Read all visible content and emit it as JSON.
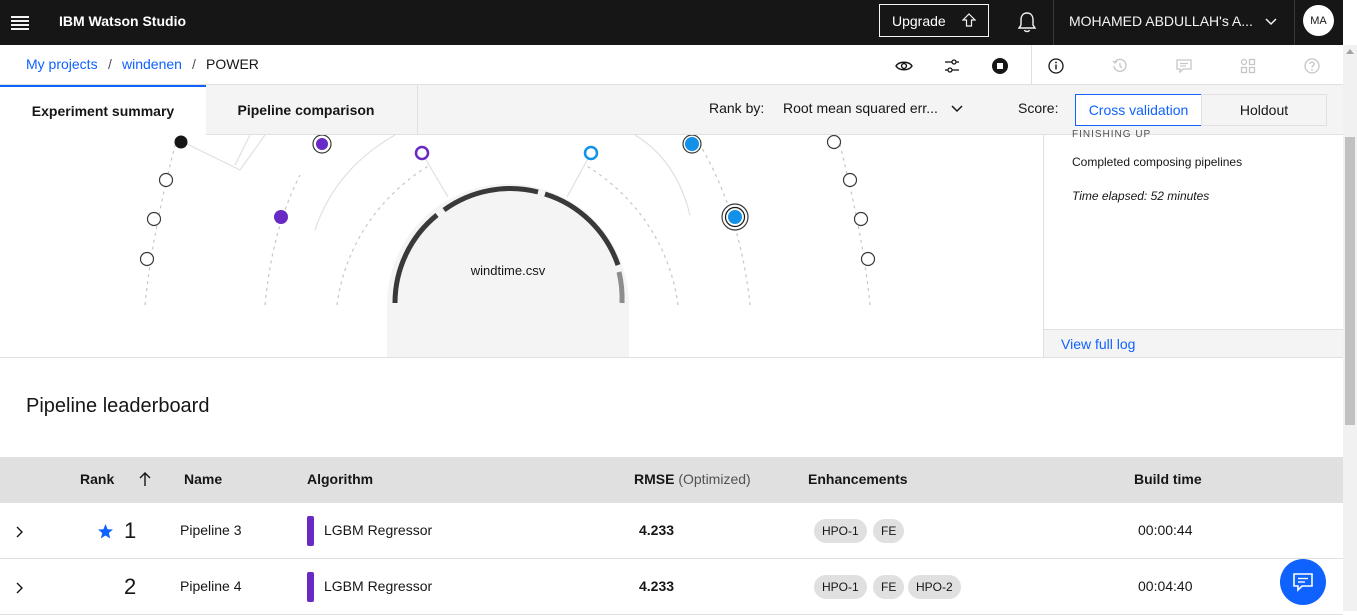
{
  "header": {
    "app_title": "IBM Watson Studio",
    "upgrade_label": "Upgrade",
    "account_name": "MOHAMED ABDULLAH's A...",
    "avatar_initials": "MA"
  },
  "breadcrumb": {
    "items": [
      "My projects",
      "windenen",
      "POWER"
    ],
    "separator": "/"
  },
  "tabs": [
    {
      "label": "Experiment summary",
      "active": true
    },
    {
      "label": "Pipeline comparison",
      "active": false
    }
  ],
  "rank_by": {
    "label": "Rank by:",
    "value": "Root mean squared err..."
  },
  "score": {
    "label": "Score:",
    "options": [
      "Cross validation",
      "Holdout"
    ],
    "selected": "Cross validation"
  },
  "visualization": {
    "center_label": "windtime.csv"
  },
  "log_panel": {
    "phase": "FINISHING UP",
    "line": "Completed composing pipelines",
    "elapsed": "Time elapsed: 52 minutes",
    "full_log_link": "View full log"
  },
  "leaderboard": {
    "title": "Pipeline leaderboard",
    "columns": {
      "rank": "Rank",
      "name": "Name",
      "algorithm": "Algorithm",
      "metric": "RMSE",
      "metric_note": "(Optimized)",
      "enhancements": "Enhancements",
      "build_time": "Build time"
    },
    "rows": [
      {
        "rank": "1",
        "starred": true,
        "name": "Pipeline 3",
        "algorithm": "LGBM Regressor",
        "rmse": "4.233",
        "enhancements": [
          "HPO-1",
          "FE"
        ],
        "build_time": "00:00:44"
      },
      {
        "rank": "2",
        "starred": false,
        "name": "Pipeline 4",
        "algorithm": "LGBM Regressor",
        "rmse": "4.233",
        "enhancements": [
          "HPO-1",
          "FE",
          "HPO-2"
        ],
        "build_time": "00:04:40"
      }
    ]
  },
  "colors": {
    "accent": "#0f62fe",
    "topbar": "#161616",
    "algo_purple": "#6929c4",
    "node_blue": "#1192e8"
  },
  "icons": [
    "menu-icon",
    "upgrade-arrow-icon",
    "bell-icon",
    "chevron-down-icon",
    "view-icon",
    "settings-sliders-icon",
    "stop-icon",
    "info-icon",
    "history-icon",
    "comment-icon",
    "tools-icon",
    "help-icon",
    "star-icon",
    "chevron-right-icon",
    "chat-icon"
  ]
}
